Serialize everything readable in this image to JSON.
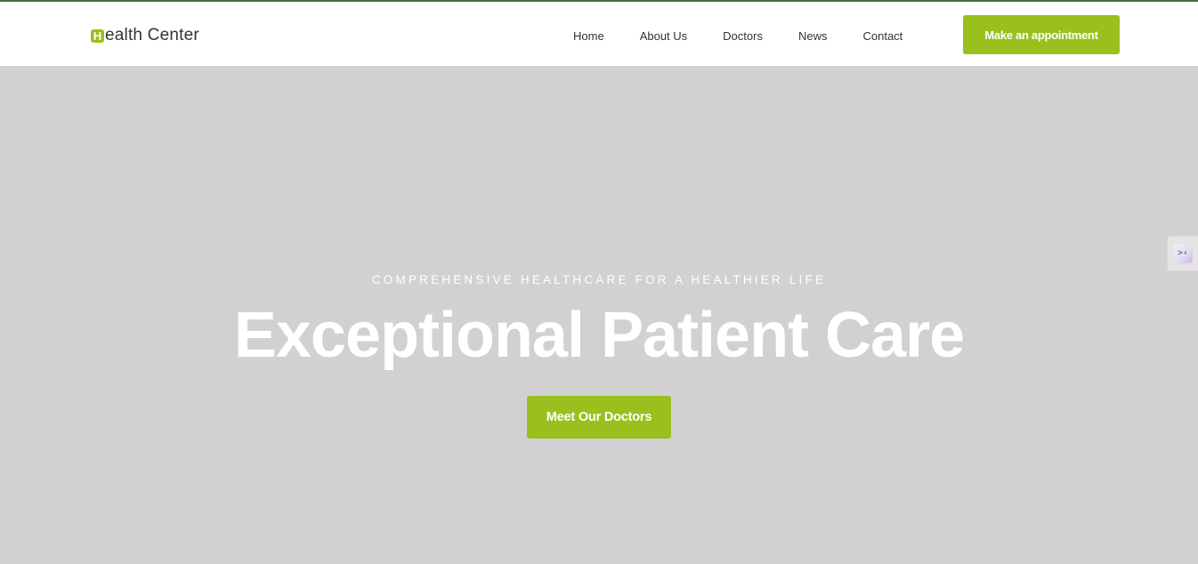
{
  "header": {
    "logo": {
      "badge": "H",
      "text": "ealth Center"
    },
    "nav": [
      {
        "label": "Home"
      },
      {
        "label": "About Us"
      },
      {
        "label": "Doctors"
      },
      {
        "label": "News"
      },
      {
        "label": "Contact"
      }
    ],
    "cta_label": "Make an appointment"
  },
  "hero": {
    "subtitle": "COMPREHENSIVE HEALTHCARE FOR A HEALTHIER LIFE",
    "title": "Exceptional Patient Care",
    "cta_label": "Meet Our Doctors"
  },
  "side_widget": {
    "icon": "code-chevrons-icon",
    "glyph": ">‹"
  },
  "colors": {
    "accent": "#9bbf1d",
    "hero_background": "#d1d1d1",
    "header_background": "#ffffff",
    "text_dark": "#333333",
    "top_line": "#3f6f3f"
  }
}
